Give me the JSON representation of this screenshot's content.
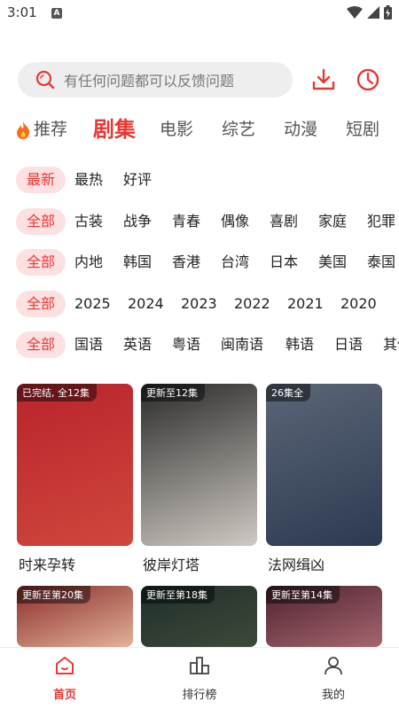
{
  "status": {
    "time": "3:01",
    "a_badge": "A"
  },
  "search": {
    "placeholder": "有任何问题都可以反馈问题"
  },
  "icons": {
    "search": "search-icon",
    "download": "download-icon",
    "history": "clock-icon",
    "fire": "fire-icon"
  },
  "tabs": [
    "推荐",
    "剧集",
    "电影",
    "综艺",
    "动漫",
    "短剧"
  ],
  "active_tab": "剧集",
  "filters": {
    "sort": [
      "最新",
      "最热",
      "好评"
    ],
    "genre": [
      "全部",
      "古装",
      "战争",
      "青春",
      "偶像",
      "喜剧",
      "家庭",
      "犯罪"
    ],
    "region": [
      "全部",
      "内地",
      "韩国",
      "香港",
      "台湾",
      "日本",
      "美国",
      "泰国"
    ],
    "year": [
      "全部",
      "2025",
      "2024",
      "2023",
      "2022",
      "2021",
      "2020"
    ],
    "language": [
      "全部",
      "国语",
      "英语",
      "粤语",
      "闽南语",
      "韩语",
      "日语",
      "其他"
    ]
  },
  "cards": [
    {
      "badge": "已完结, 全12集",
      "title": "时来孕转",
      "colors": [
        "#b8242c",
        "#d0473c"
      ]
    },
    {
      "badge": "更新至12集",
      "title": "彼岸灯塔",
      "colors": [
        "#2b2b2b",
        "#cfc9c2"
      ]
    },
    {
      "badge": "26集全",
      "title": "法网缉凶",
      "colors": [
        "#5b6576",
        "#2c3a52"
      ]
    },
    {
      "badge": "更新至第20集",
      "title": "",
      "colors": [
        "#8a2d2a",
        "#e3b199"
      ]
    },
    {
      "badge": "更新至第18集",
      "title": "",
      "colors": [
        "#1f2e2a",
        "#3d4a3a"
      ]
    },
    {
      "badge": "更新至第14集",
      "title": "",
      "colors": [
        "#4d2230",
        "#a6666e"
      ]
    }
  ],
  "nav": {
    "home": "首页",
    "ranking": "排行榜",
    "mine": "我的"
  },
  "colors": {
    "accent": "#e53935",
    "chip_bg": "#fde0e0"
  }
}
